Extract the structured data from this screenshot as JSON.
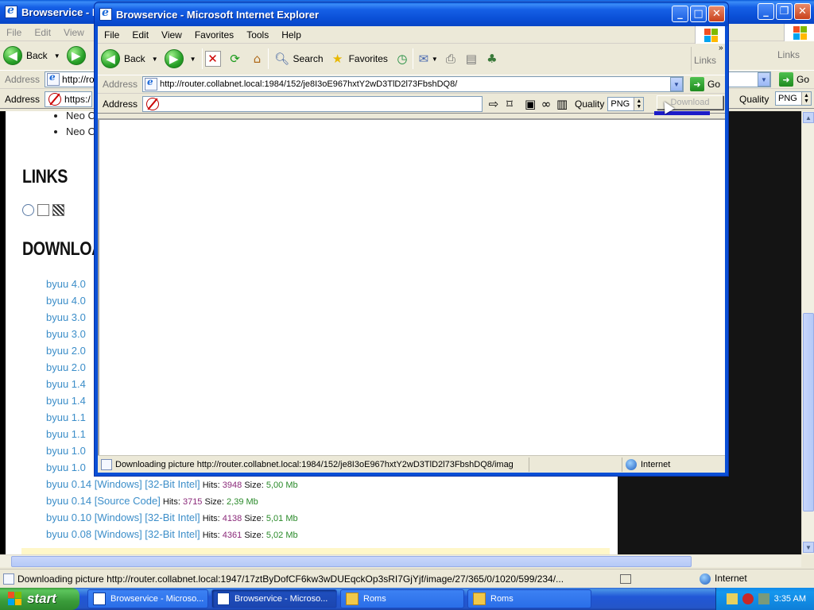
{
  "bg_window": {
    "title": "Browservice - M",
    "menu": [
      "File",
      "Edit",
      "View",
      "F"
    ],
    "toolbar": {
      "back_label": "Back",
      "links_label": "Links"
    },
    "address": {
      "label": "Address",
      "url": "http://ro",
      "go_label": "Go"
    },
    "bs_bar": {
      "address_label": "Address",
      "url": "https:/",
      "quality_label": "Quality",
      "quality_value": "PNG"
    },
    "page": {
      "list_items": [
        "Neo C",
        "Neo C"
      ],
      "links_heading": "LINKS",
      "downloads_heading": "DOWNLOAD",
      "downloads": [
        {
          "name": "byuu 4.0",
          "meta": ""
        },
        {
          "name": "byuu 4.0",
          "meta": ""
        },
        {
          "name": "byuu 3.0",
          "meta": ""
        },
        {
          "name": "byuu 3.0",
          "meta": ""
        },
        {
          "name": "byuu 2.0",
          "meta": ""
        },
        {
          "name": "byuu 2.0",
          "meta": ""
        },
        {
          "name": "byuu 1.4",
          "meta": ""
        },
        {
          "name": "byuu 1.4",
          "meta": ""
        },
        {
          "name": "byuu 1.1",
          "meta": ""
        },
        {
          "name": "byuu 1.1",
          "meta": ""
        },
        {
          "name": "byuu 1.0",
          "meta": ""
        },
        {
          "name": "byuu 1.0",
          "meta": ""
        },
        {
          "name": "byuu 0.14 [Windows] [32-Bit Intel]",
          "hits_label": "Hits:",
          "hits": "3948",
          "size_label": "Size:",
          "size": "5,00 Mb"
        },
        {
          "name": "byuu 0.14 [Source Code]",
          "hits_label": "Hits:",
          "hits": "3715",
          "size_label": "Size:",
          "size": "2,39 Mb"
        },
        {
          "name": "byuu 0.10 [Windows] [32-Bit Intel]",
          "hits_label": "Hits:",
          "hits": "4138",
          "size_label": "Size:",
          "size": "5,01 Mb"
        },
        {
          "name": "byuu 0.08 [Windows] [32-Bit Intel]",
          "hits_label": "Hits:",
          "hits": "4361",
          "size_label": "Size:",
          "size": "5,02 Mb"
        }
      ]
    },
    "status": {
      "text": "Downloading picture http://router.collabnet.local:1947/17ztByDofCF6kw3wDUEqckOp3sRI7GjYjf/image/27/365/0/1020/599/234/...",
      "zone": "Internet"
    }
  },
  "fg_window": {
    "title": "Browservice - Microsoft Internet Explorer",
    "menu": [
      "File",
      "Edit",
      "View",
      "Favorites",
      "Tools",
      "Help"
    ],
    "toolbar": {
      "back_label": "Back",
      "search_label": "Search",
      "favorites_label": "Favorites",
      "links_label": "Links"
    },
    "address": {
      "label": "Address",
      "url": "http://router.collabnet.local:1984/152/je8I3oE967hxtY2wD3TlD2l73FbshDQ8/",
      "go_label": "Go"
    },
    "bs_bar": {
      "address_label": "Address",
      "url": "",
      "quality_label": "Quality",
      "quality_value": "PNG",
      "download_label": "Download"
    },
    "status": {
      "text": "Downloading picture http://router.collabnet.local:1984/152/je8I3oE967hxtY2wD3TlD2l73FbshDQ8/imag",
      "zone": "Internet"
    }
  },
  "taskbar": {
    "start_label": "start",
    "tasks": [
      {
        "label": "Browservice - Microso...",
        "active": false,
        "icon": "ie-icon"
      },
      {
        "label": "Browservice - Microso...",
        "active": true,
        "icon": "ie-icon"
      },
      {
        "label": "Roms",
        "active": false,
        "icon": "folder-icon"
      },
      {
        "label": "Roms",
        "active": false,
        "icon": "folder-icon"
      }
    ],
    "clock": "3:35 AM"
  },
  "colors": {
    "link": "#3c8ec9",
    "hits": "#8b2a7a",
    "size": "#2a8a2a",
    "title_blue": "#0a4fd6",
    "taskbar_blue": "#2457d0",
    "start_green": "#3a9c3a"
  }
}
